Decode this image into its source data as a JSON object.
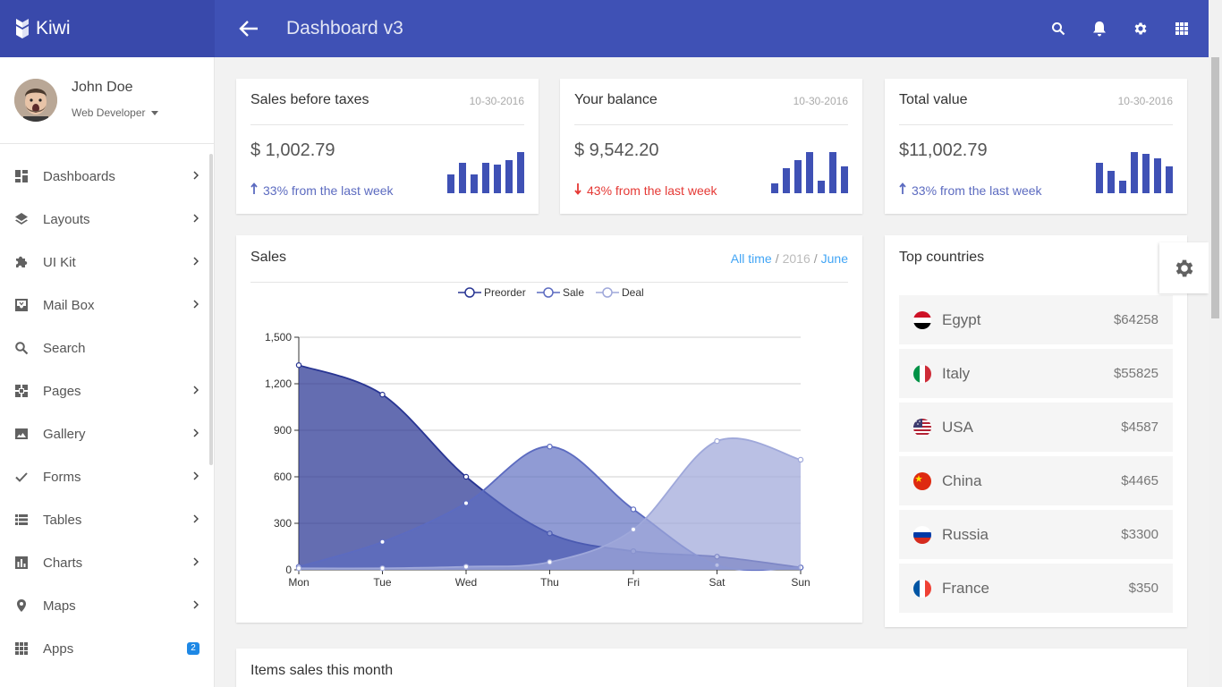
{
  "app": {
    "brand": "Kiwi",
    "page_title": "Dashboard v3"
  },
  "topbar": {
    "icons": [
      "search-icon",
      "bell-icon",
      "gear-icon",
      "apps-grid-icon"
    ]
  },
  "user": {
    "name": "John Doe",
    "role": "Web Developer"
  },
  "sidebar": {
    "items": [
      {
        "label": "Dashboards",
        "icon": "dashboard-icon",
        "chevron": true
      },
      {
        "label": "Layouts",
        "icon": "layers-icon",
        "chevron": true
      },
      {
        "label": "UI Kit",
        "icon": "puzzle-icon",
        "chevron": true
      },
      {
        "label": "Mail Box",
        "icon": "inbox-icon",
        "chevron": true
      },
      {
        "label": "Search",
        "icon": "search-icon",
        "chevron": false
      },
      {
        "label": "Pages",
        "icon": "pages-icon",
        "chevron": true
      },
      {
        "label": "Gallery",
        "icon": "image-icon",
        "chevron": true
      },
      {
        "label": "Forms",
        "icon": "check-icon",
        "chevron": true
      },
      {
        "label": "Tables",
        "icon": "table-icon",
        "chevron": true
      },
      {
        "label": "Charts",
        "icon": "bar-chart-icon",
        "chevron": true
      },
      {
        "label": "Maps",
        "icon": "map-pin-icon",
        "chevron": true
      },
      {
        "label": "Apps",
        "icon": "apps-grid-icon",
        "chevron": false,
        "badge": "2"
      }
    ]
  },
  "stats": [
    {
      "title": "Sales before taxes",
      "date": "10-30-2016",
      "value": "$ 1,002.79",
      "change": "33% from the last week",
      "direction": "up",
      "bars": [
        0.45,
        0.75,
        0.45,
        0.75,
        0.7,
        0.8,
        1.0
      ]
    },
    {
      "title": "Your balance",
      "date": "10-30-2016",
      "value": "$ 9,542.20",
      "change": "43% from the last week",
      "direction": "down",
      "bars": [
        0.25,
        0.6,
        0.8,
        1.0,
        0.3,
        1.0,
        0.65
      ]
    },
    {
      "title": "Total value",
      "date": "10-30-2016",
      "value": "$11,002.79",
      "change": "33% from the last week",
      "direction": "up",
      "bars": [
        0.75,
        0.55,
        0.3,
        1.0,
        0.95,
        0.85,
        0.65
      ]
    }
  ],
  "sales": {
    "title": "Sales",
    "filters": {
      "all_time": "All time",
      "year": "2016",
      "month": "June"
    }
  },
  "chart_data": {
    "type": "area",
    "title": "",
    "xlabel": "",
    "ylabel": "",
    "categories": [
      "Mon",
      "Tue",
      "Wed",
      "Thu",
      "Fri",
      "Sat",
      "Sun"
    ],
    "ylim": [
      0,
      1500
    ],
    "yticks": [
      "0",
      "300",
      "600",
      "900",
      "1,200",
      "1,500"
    ],
    "legend_position": "top-center",
    "series": [
      {
        "name": "Preorder",
        "values": [
          1320,
          1130,
          600,
          235,
          120,
          85,
          15
        ],
        "color": "#283593"
      },
      {
        "name": "Sale",
        "values": [
          20,
          180,
          430,
          795,
          390,
          30,
          15
        ],
        "color": "#5c6bc0"
      },
      {
        "name": "Deal",
        "values": [
          10,
          10,
          20,
          50,
          260,
          830,
          710
        ],
        "color": "#9fa8da"
      }
    ]
  },
  "countries": {
    "title": "Top countries",
    "items": [
      {
        "name": "Egypt",
        "value": "$64258",
        "flag": [
          "#ce1126",
          "#ffffff",
          "#000000"
        ],
        "flag_type": "h3"
      },
      {
        "name": "Italy",
        "value": "$55825",
        "flag": [
          "#009246",
          "#ffffff",
          "#ce2b37"
        ],
        "flag_type": "v3"
      },
      {
        "name": "USA",
        "value": "$4587",
        "flag": [
          "#b22234",
          "#ffffff",
          "#3c3b6e"
        ],
        "flag_type": "us"
      },
      {
        "name": "China",
        "value": "$4465",
        "flag": [
          "#de2910",
          "#ffde00"
        ],
        "flag_type": "cn"
      },
      {
        "name": "Russia",
        "value": "$3300",
        "flag": [
          "#ffffff",
          "#0039a6",
          "#d52b1e"
        ],
        "flag_type": "h3"
      },
      {
        "name": "France",
        "value": "$350",
        "flag": [
          "#0055a4",
          "#ffffff",
          "#ef4135"
        ],
        "flag_type": "v3"
      }
    ]
  },
  "items_sales": {
    "title": "Items sales this month"
  },
  "colors": {
    "primary": "#3f51b5",
    "brand_bg": "#3949ab",
    "up": "#5c6bc0",
    "down": "#e53935",
    "link": "#42a5f5"
  }
}
